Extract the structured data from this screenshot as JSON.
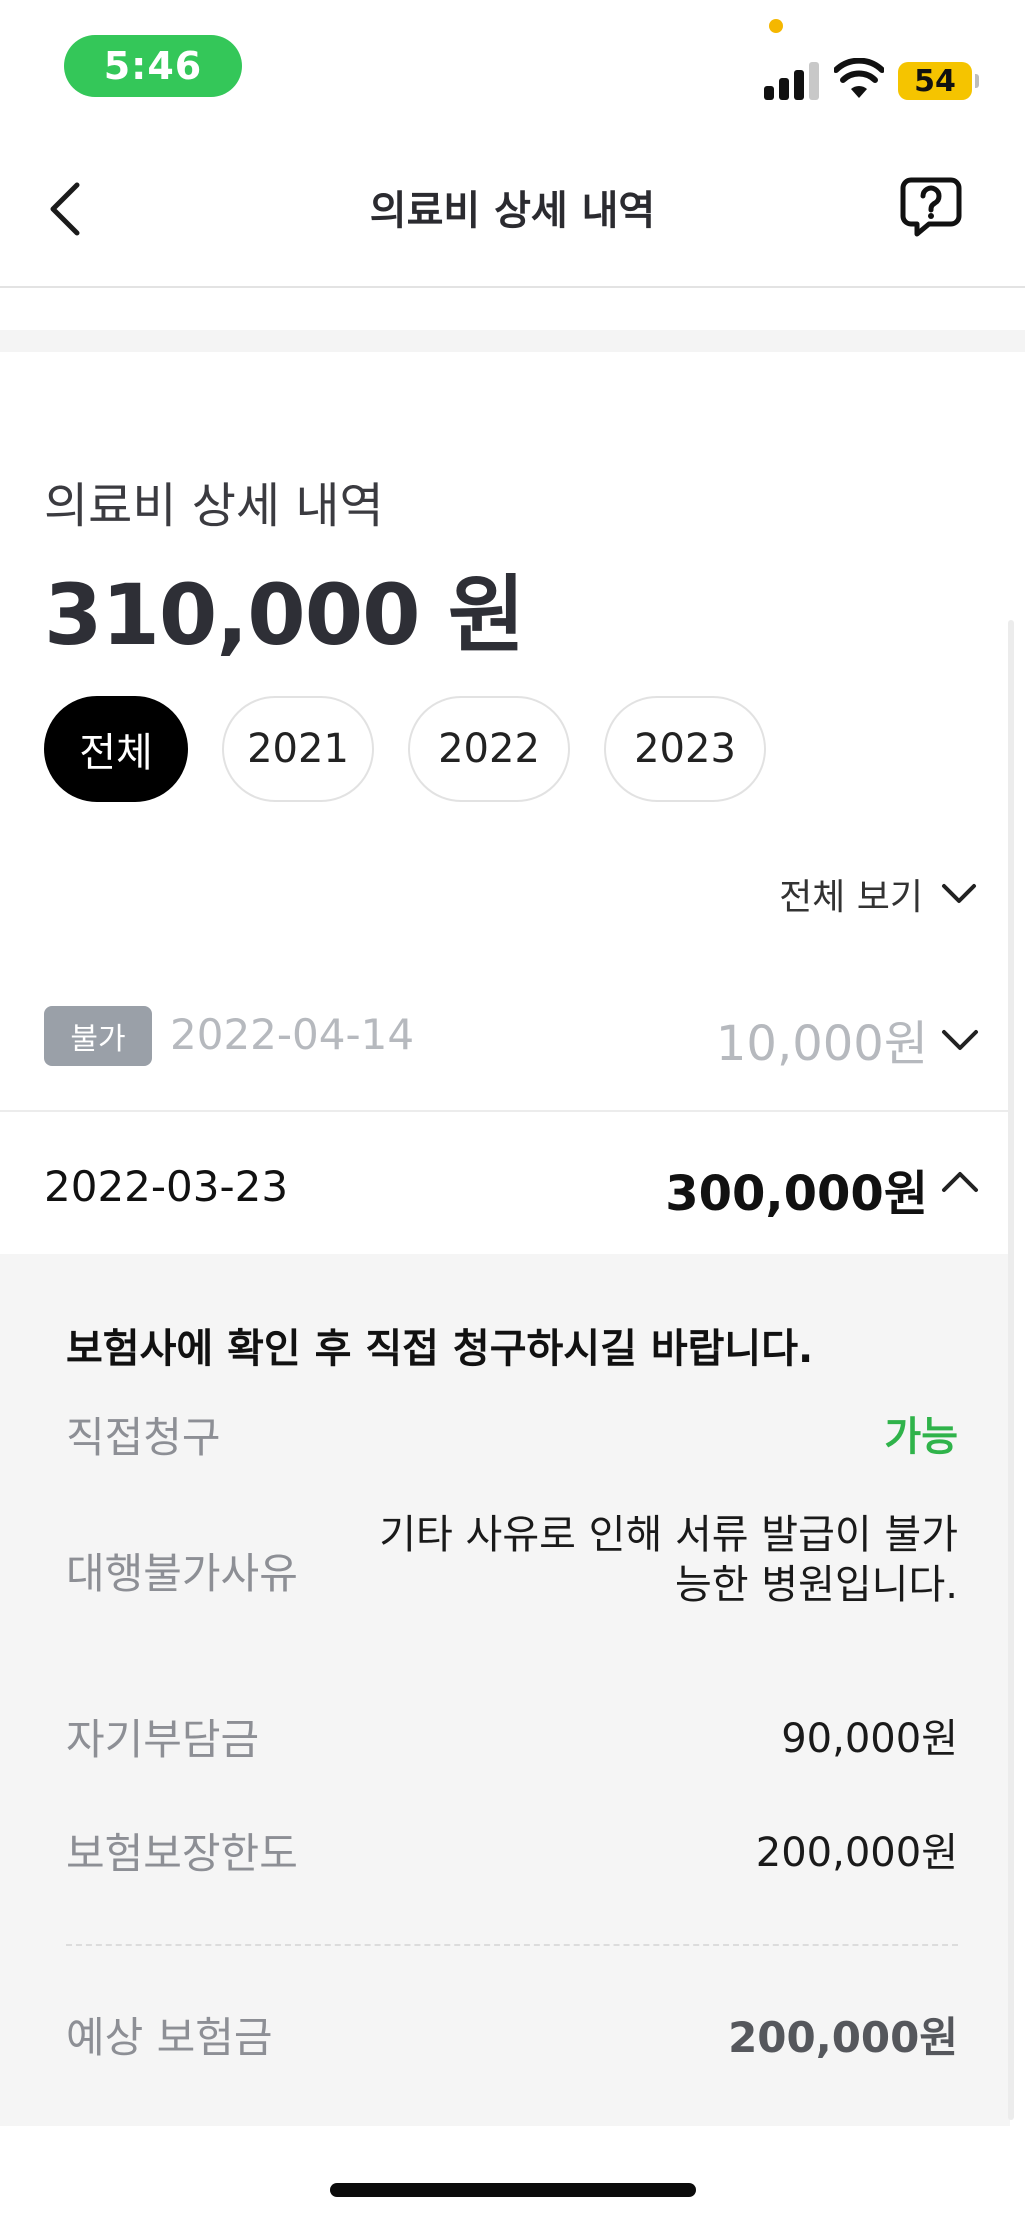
{
  "status_bar": {
    "time": "5:46",
    "battery": "54",
    "colors": {
      "time_pill": "#34c759",
      "battery": "#f5c400",
      "camera_dot": "#f5b700"
    }
  },
  "header": {
    "title": "의료비 상세 내역",
    "back_icon": "chevron-left-icon",
    "help_icon": "question-bubble-icon"
  },
  "summary": {
    "label": "의료비 상세 내역",
    "total": "310,000 원"
  },
  "year_tabs": [
    {
      "label": "전체",
      "active": true
    },
    {
      "label": "2021",
      "active": false
    },
    {
      "label": "2022",
      "active": false
    },
    {
      "label": "2023",
      "active": false
    }
  ],
  "filter": {
    "label": "전체 보기",
    "icon": "chevron-down-icon"
  },
  "records": [
    {
      "badge": "불가",
      "date": "2022-04-14",
      "amount": "10,000원",
      "expanded": false
    },
    {
      "badge": "",
      "date": "2022-03-23",
      "amount": "300,000원",
      "expanded": true
    }
  ],
  "detail": {
    "notice": "보험사에 확인 후 직접 청구하시길 바랍니다.",
    "rows": [
      {
        "label": "직접청구",
        "value": "가능"
      },
      {
        "label": "대행불가사유",
        "value_lines": [
          "기타 사유로 인해 서류 발급이 불가",
          "능한 병원입니다."
        ]
      },
      {
        "label": "자기부담금",
        "value": "90,000원"
      },
      {
        "label": "보험보장한도",
        "value": "200,000원"
      }
    ],
    "expected": {
      "label": "예상 보험금",
      "value": "200,000원"
    }
  },
  "accent_colors": {
    "positive": "#2fb34a",
    "disabled_badge": "#9aa0a8",
    "active_tab": "#000000"
  }
}
